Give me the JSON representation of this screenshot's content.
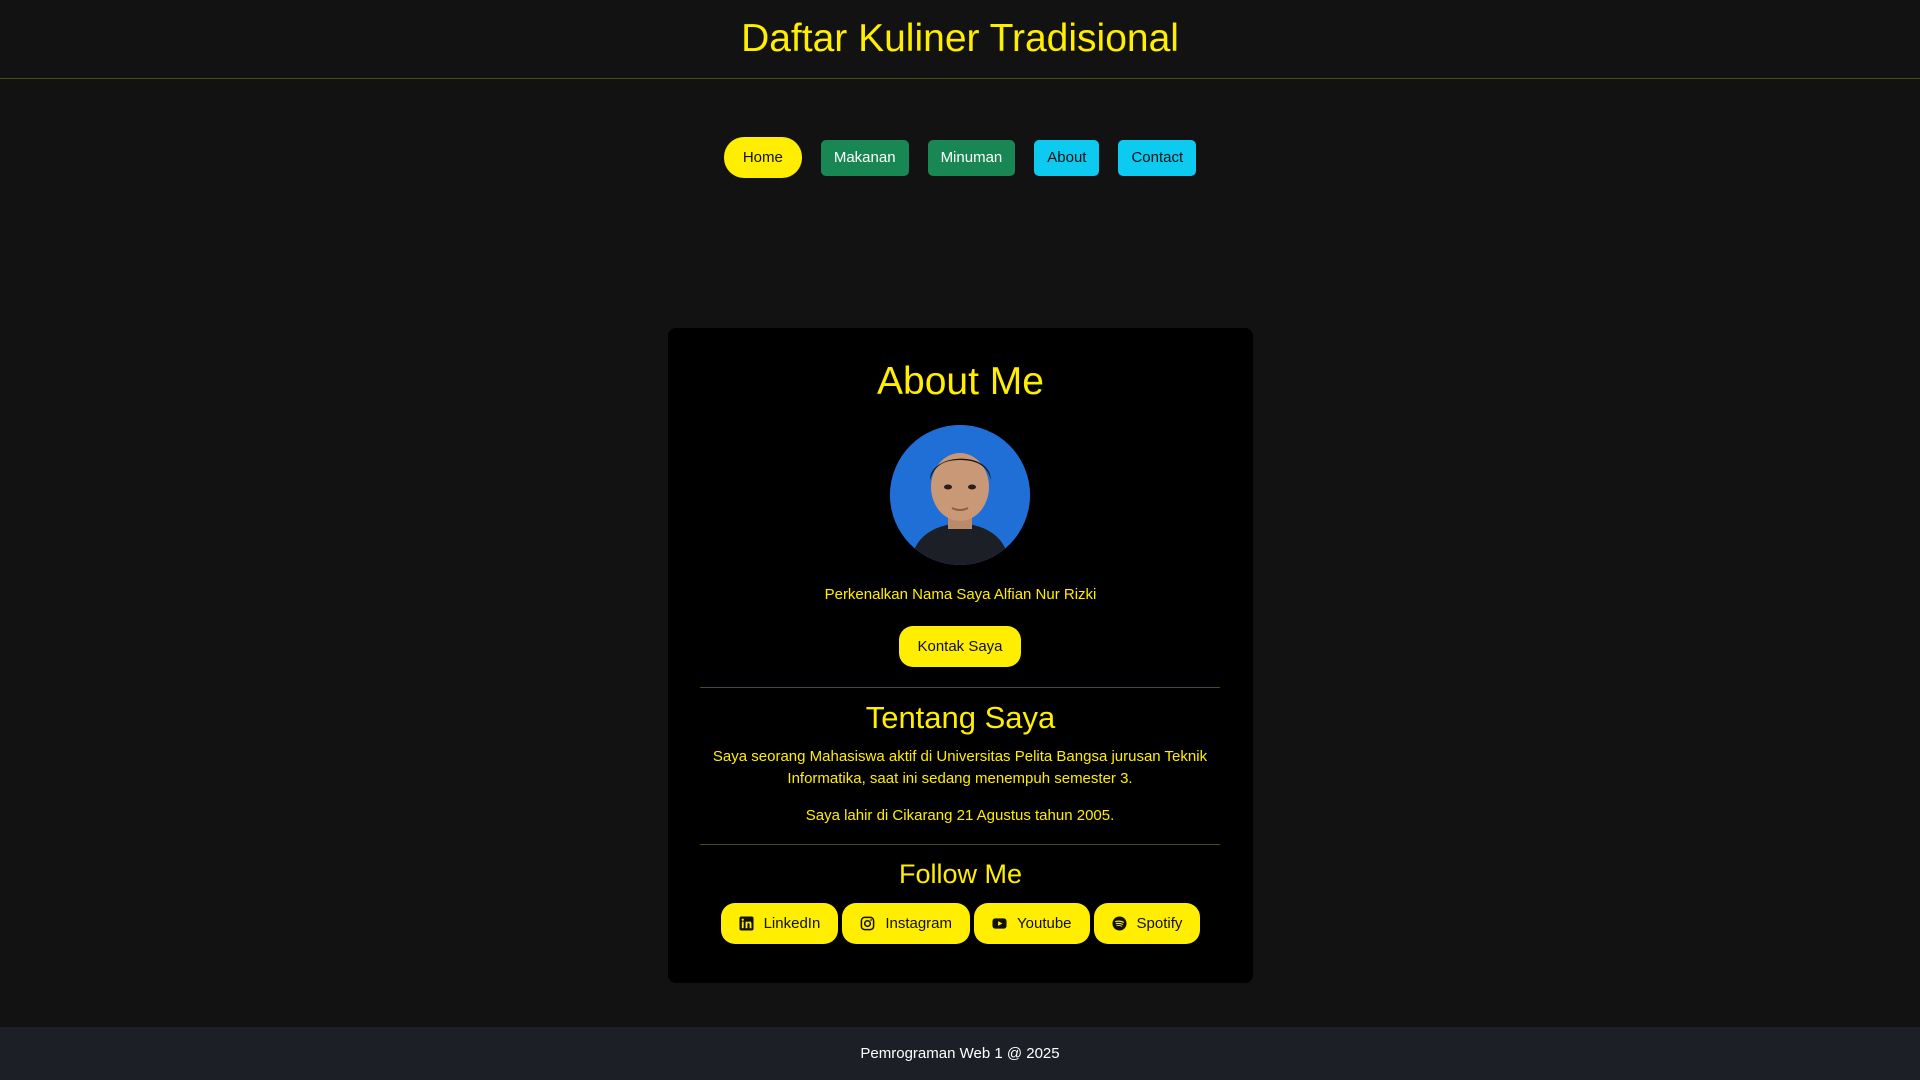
{
  "header": {
    "title": "Daftar Kuliner Tradisional"
  },
  "nav": {
    "home": "Home",
    "makanan": "Makanan",
    "minuman": "Minuman",
    "about": "About",
    "contact": "Contact"
  },
  "card": {
    "title": "About Me",
    "intro": "Perkenalkan Nama Saya Alfian Nur Rizki",
    "contact_button": "Kontak Saya",
    "tentang_title": "Tentang Saya",
    "tentang_p1": "Saya seorang Mahasiswa aktif di Universitas Pelita Bangsa jurusan Teknik Informatika, saat ini sedang menempuh semester 3.",
    "tentang_p2": "Saya lahir di Cikarang 21 Agustus tahun 2005.",
    "follow_title": "Follow Me",
    "socials": [
      {
        "label": "LinkedIn",
        "icon": "linkedin-icon"
      },
      {
        "label": "Instagram",
        "icon": "instagram-icon"
      },
      {
        "label": "Youtube",
        "icon": "youtube-icon"
      },
      {
        "label": "Spotify",
        "icon": "spotify-icon"
      }
    ]
  },
  "footer": {
    "text": "Pemrograman Web 1 @ 2025"
  },
  "colors": {
    "accent": "#ffee00",
    "background": "#121212",
    "card": "#000000",
    "green_button": "#198754",
    "cyan_button": "#0dcaf0",
    "footer": "#1c2026"
  }
}
